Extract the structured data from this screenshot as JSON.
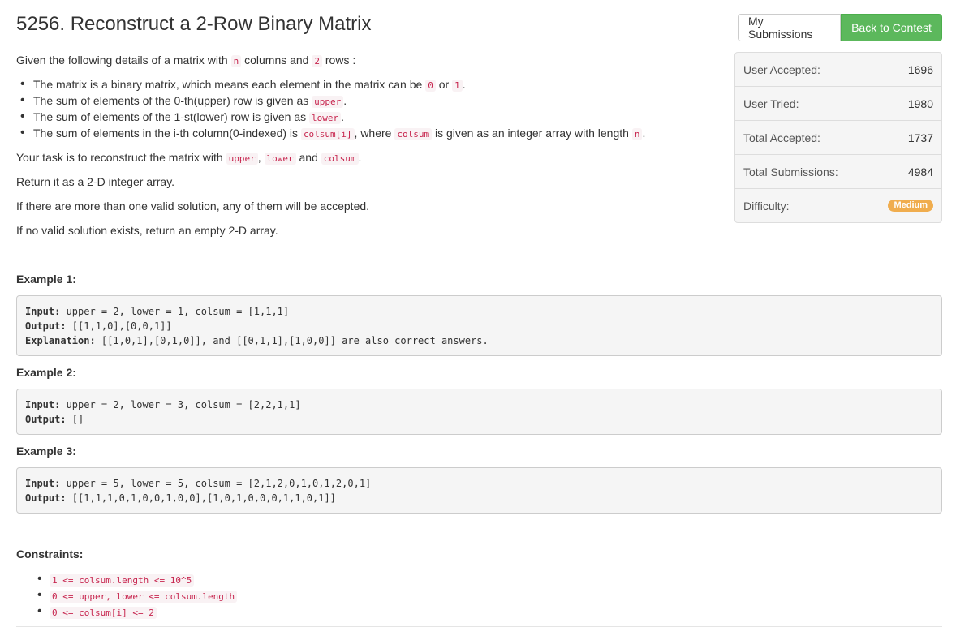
{
  "title": "5256. Reconstruct a 2-Row Binary Matrix",
  "buttons": {
    "my_submissions": "My Submissions",
    "back_to_contest": "Back to Contest"
  },
  "stats": [
    {
      "label": "User Accepted:",
      "value": "1696"
    },
    {
      "label": "User Tried:",
      "value": "1980"
    },
    {
      "label": "Total Accepted:",
      "value": "1737"
    },
    {
      "label": "Total Submissions:",
      "value": "4984"
    },
    {
      "label": "Difficulty:",
      "value": "Medium"
    }
  ],
  "colors": {
    "success": "#5cb85c",
    "difficulty_medium": "#f0ad4e",
    "code": "#c7254e"
  },
  "description": {
    "intro": [
      "Given the following details of a matrix with ",
      "n",
      " columns and ",
      "2",
      " rows :"
    ],
    "bullets": [
      [
        "The matrix is a binary matrix, which means each element in the matrix can be ",
        "0",
        " or ",
        "1",
        "."
      ],
      [
        "The sum of elements of the 0-th(upper) row is given as ",
        "upper",
        "."
      ],
      [
        "The sum of elements of the 1-st(lower) row is given as ",
        "lower",
        "."
      ],
      [
        "The sum of elements in the i-th column(0-indexed) is ",
        "colsum[i]",
        ", where ",
        "colsum",
        " is given as an integer array with length ",
        "n",
        "."
      ]
    ],
    "task": [
      "Your task is to reconstruct the matrix with ",
      "upper",
      ", ",
      "lower",
      " and ",
      "colsum",
      "."
    ],
    "ret": "Return it as a 2-D integer array.",
    "multi": "If there are more than one valid solution, any of them will be accepted.",
    "none": "If no valid solution exists, return an empty 2-D array."
  },
  "examples": [
    {
      "title": "Example 1:",
      "lines": [
        {
          "label": "Input:",
          "text": " upper = 2, lower = 1, colsum = [1,1,1]"
        },
        {
          "label": "Output:",
          "text": " [[1,1,0],[0,0,1]]"
        },
        {
          "label": "Explanation:",
          "text": " [[1,0,1],[0,1,0]], and [[0,1,1],[1,0,0]] are also correct answers."
        }
      ]
    },
    {
      "title": "Example 2:",
      "lines": [
        {
          "label": "Input:",
          "text": " upper = 2, lower = 3, colsum = [2,2,1,1]"
        },
        {
          "label": "Output:",
          "text": " []"
        }
      ]
    },
    {
      "title": "Example 3:",
      "lines": [
        {
          "label": "Input:",
          "text": " upper = 5, lower = 5, colsum = [2,1,2,0,1,0,1,2,0,1]"
        },
        {
          "label": "Output:",
          "text": " [[1,1,1,0,1,0,0,1,0,0],[1,0,1,0,0,0,1,1,0,1]]"
        }
      ]
    }
  ],
  "constraints": {
    "title": "Constraints:",
    "items": [
      "1 <= colsum.length <= 10^5",
      "0 <= upper, lower <= colsum.length",
      "0 <= colsum[i] <= 2"
    ]
  }
}
